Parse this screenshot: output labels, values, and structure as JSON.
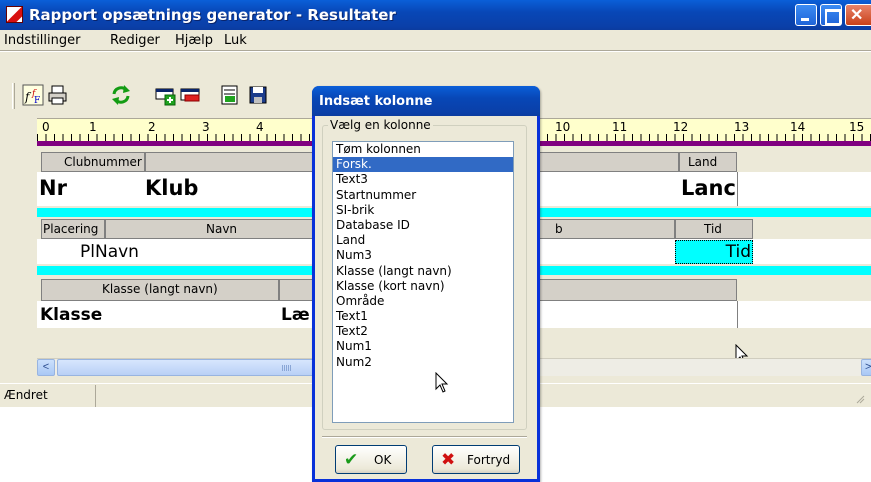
{
  "window": {
    "title": "Rapport opsætnings generator - Resultater"
  },
  "menu": {
    "items": [
      "Indstillinger",
      "Rediger",
      "Hjælp",
      "Luk"
    ]
  },
  "toolbar": {
    "icons": [
      "font-format-icon",
      "print-icon",
      "refresh-icon",
      "add-row-icon",
      "remove-row-icon",
      "add-column-icon",
      "save-icon"
    ]
  },
  "ruler": {
    "numbers": [
      "0",
      "1",
      "2",
      "3",
      "4",
      "10",
      "11",
      "12",
      "13",
      "14",
      "15"
    ]
  },
  "design": {
    "header_row": {
      "clubnummer_label": "Clubnummer",
      "land_label": "Land",
      "nr_value": "Nr",
      "klub_value": "Klub",
      "land_value": "Lanc"
    },
    "result_row": {
      "placering_label": "Placering",
      "navn_label": "Navn",
      "b_label": "b",
      "tid_label": "Tid",
      "pl_navn_value": "PlNavn",
      "tid_value": "Tid"
    },
    "class_row": {
      "klasse_label": "Klasse (langt navn)",
      "klasse_value": "Klasse",
      "lae_value": "Læ"
    },
    "accent_color": "#00ffff",
    "ruler_bar_color": "#800080"
  },
  "status": {
    "text": "Ændret"
  },
  "dialog": {
    "title": "Indsæt kolonne",
    "group_label": "Vælg en kolonne",
    "items": [
      "Tøm kolonnen",
      "Forsk.",
      "Text3",
      "Startnummer",
      "SI-brik",
      "Database ID",
      "Land",
      "Num3",
      "Klasse (langt navn)",
      "Klasse (kort navn)",
      "Område",
      "Text1",
      "Text2",
      "Num1",
      "Num2"
    ],
    "selected_index": 1,
    "ok_label": "OK",
    "cancel_label": "Fortryd",
    "selection_color": "#316ac5"
  }
}
